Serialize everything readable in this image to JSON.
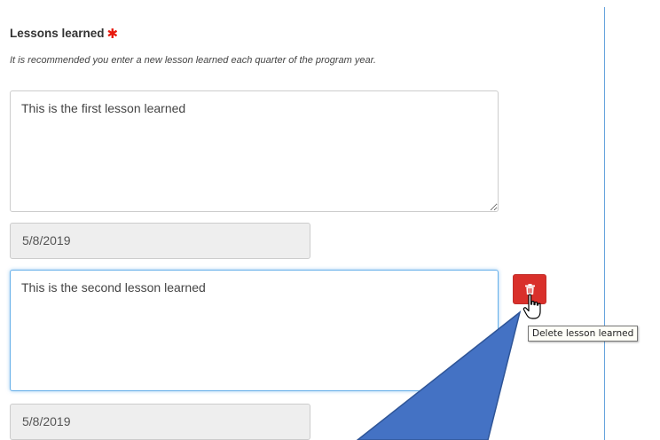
{
  "section": {
    "title": "Lessons learned",
    "required_marker": "✱",
    "hint": "It is recommended you enter a new lesson learned each quarter of the program year."
  },
  "lessons": [
    {
      "text": "This is the first lesson learned",
      "date": "5/8/2019"
    },
    {
      "text": "This is the second lesson learned",
      "date": "5/8/2019"
    }
  ],
  "delete_button": {
    "icon": "trash-icon",
    "tooltip": "Delete lesson learned"
  },
  "colors": {
    "required": "#e8180c",
    "delete_button": "#d9302b",
    "focus_border": "#66afe9",
    "callout_fill": "#4472c4",
    "divider": "#66a3dd"
  }
}
